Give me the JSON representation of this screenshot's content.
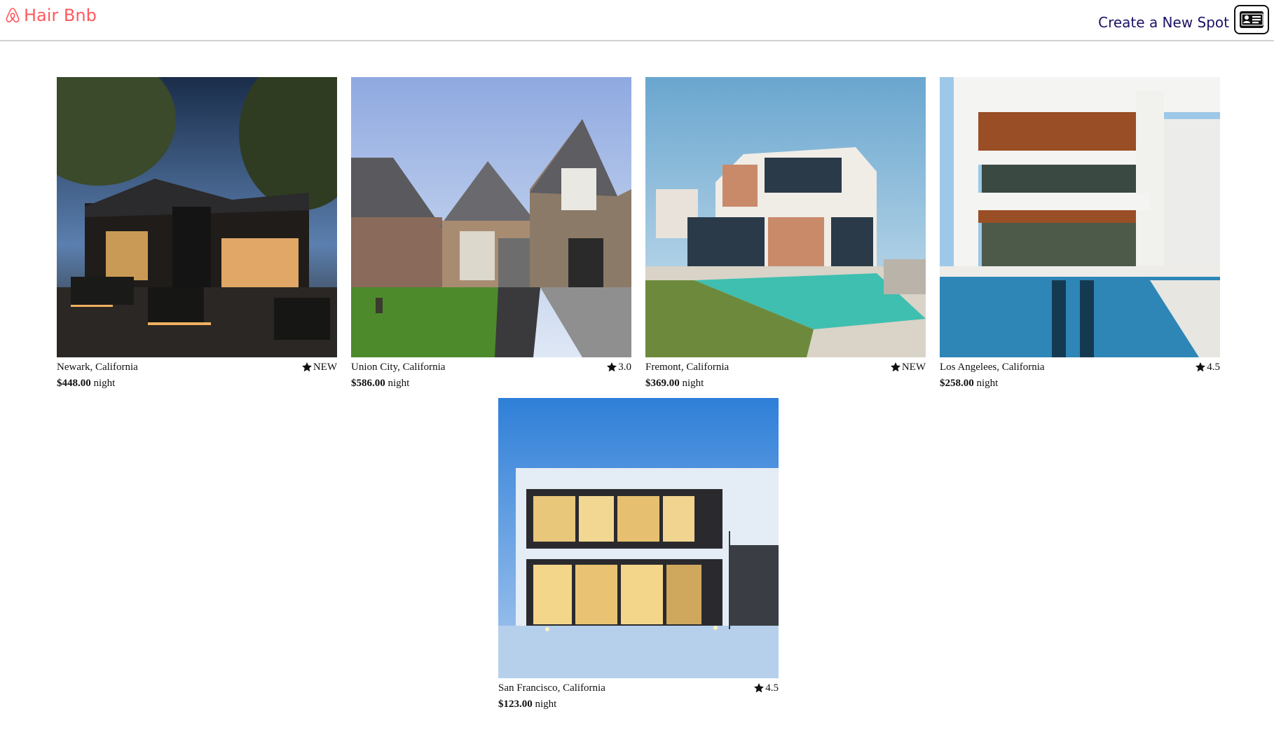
{
  "header": {
    "logo_text": "Hair Bnb",
    "create_spot_label": "Create a New Spot",
    "profile_icon": "id-card-icon"
  },
  "colors": {
    "brand": "#ff5a5f",
    "link": "#1b1464",
    "text": "#111111",
    "divider": "#d2d2d2"
  },
  "spots": [
    {
      "location": "Newark, California",
      "rating": "NEW",
      "price": "$448.00",
      "unit": "night",
      "image": "modern-lit-house-at-dusk"
    },
    {
      "location": "Union City, California",
      "rating": "3.0",
      "price": "$586.00",
      "unit": "night",
      "image": "suburban-brick-houses"
    },
    {
      "location": "Fremont, California",
      "rating": "NEW",
      "price": "$369.00",
      "unit": "night",
      "image": "modern-villa-with-pool"
    },
    {
      "location": "Los Angelees, California",
      "rating": "4.5",
      "price": "$258.00",
      "unit": "night",
      "image": "white-modern-house-with-pool"
    },
    {
      "location": "San Francisco, California",
      "rating": "4.5",
      "price": "$123.00",
      "unit": "night",
      "image": "glass-house-in-snow"
    }
  ]
}
